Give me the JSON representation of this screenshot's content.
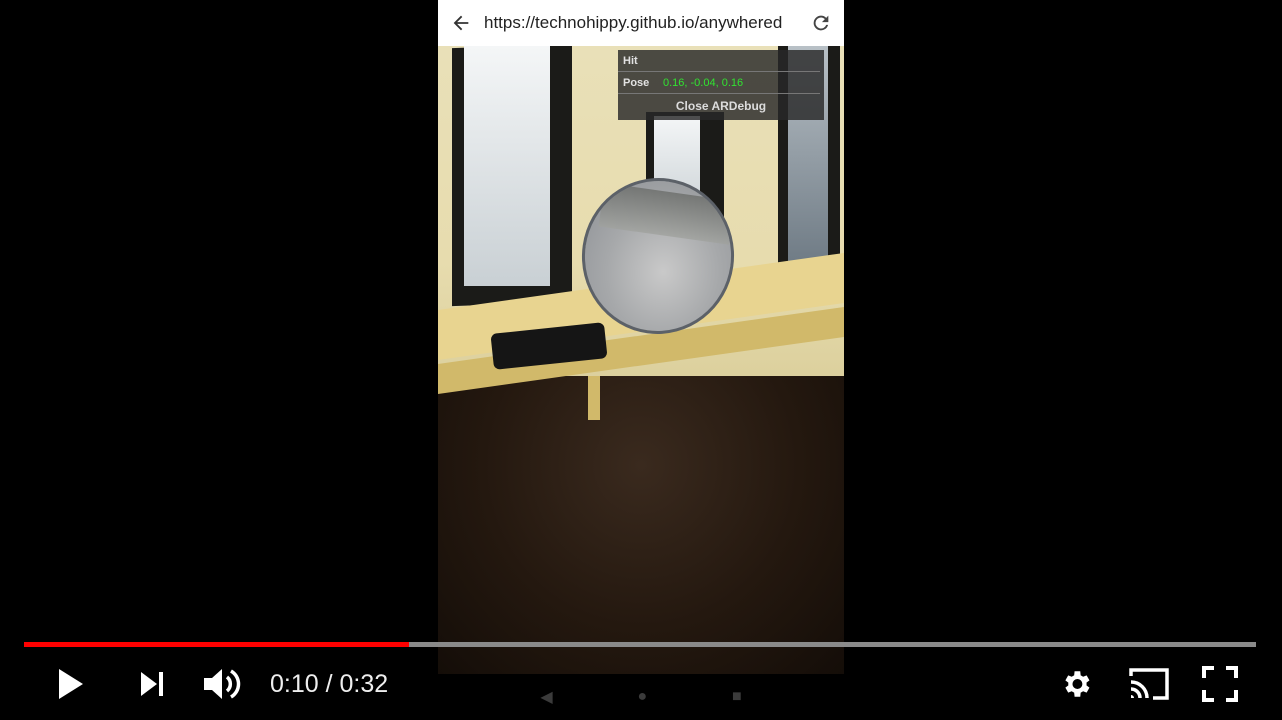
{
  "browser": {
    "url": "https://technohippy.github.io/anywhered",
    "back_icon": "arrow-back-icon",
    "reload_icon": "reload-icon"
  },
  "ardebug": {
    "hit_label": "Hit",
    "hit_value": "",
    "pose_label": "Pose",
    "pose_value": "0.16, -0.04, 0.16",
    "close_label": "Close ARDebug"
  },
  "android_nav": {
    "back_glyph": "◀",
    "home_glyph": "●",
    "recents_glyph": "■"
  },
  "player": {
    "current_time": "0:10",
    "duration": "0:32",
    "time_display": "0:10 / 0:32",
    "progress_fraction": 0.3125,
    "accent_color": "#ff0000",
    "play_icon": "play-icon",
    "next_icon": "skip-next-icon",
    "volume_icon": "volume-icon",
    "settings_icon": "gear-icon",
    "cast_icon": "cast-icon",
    "fullscreen_icon": "fullscreen-icon"
  }
}
